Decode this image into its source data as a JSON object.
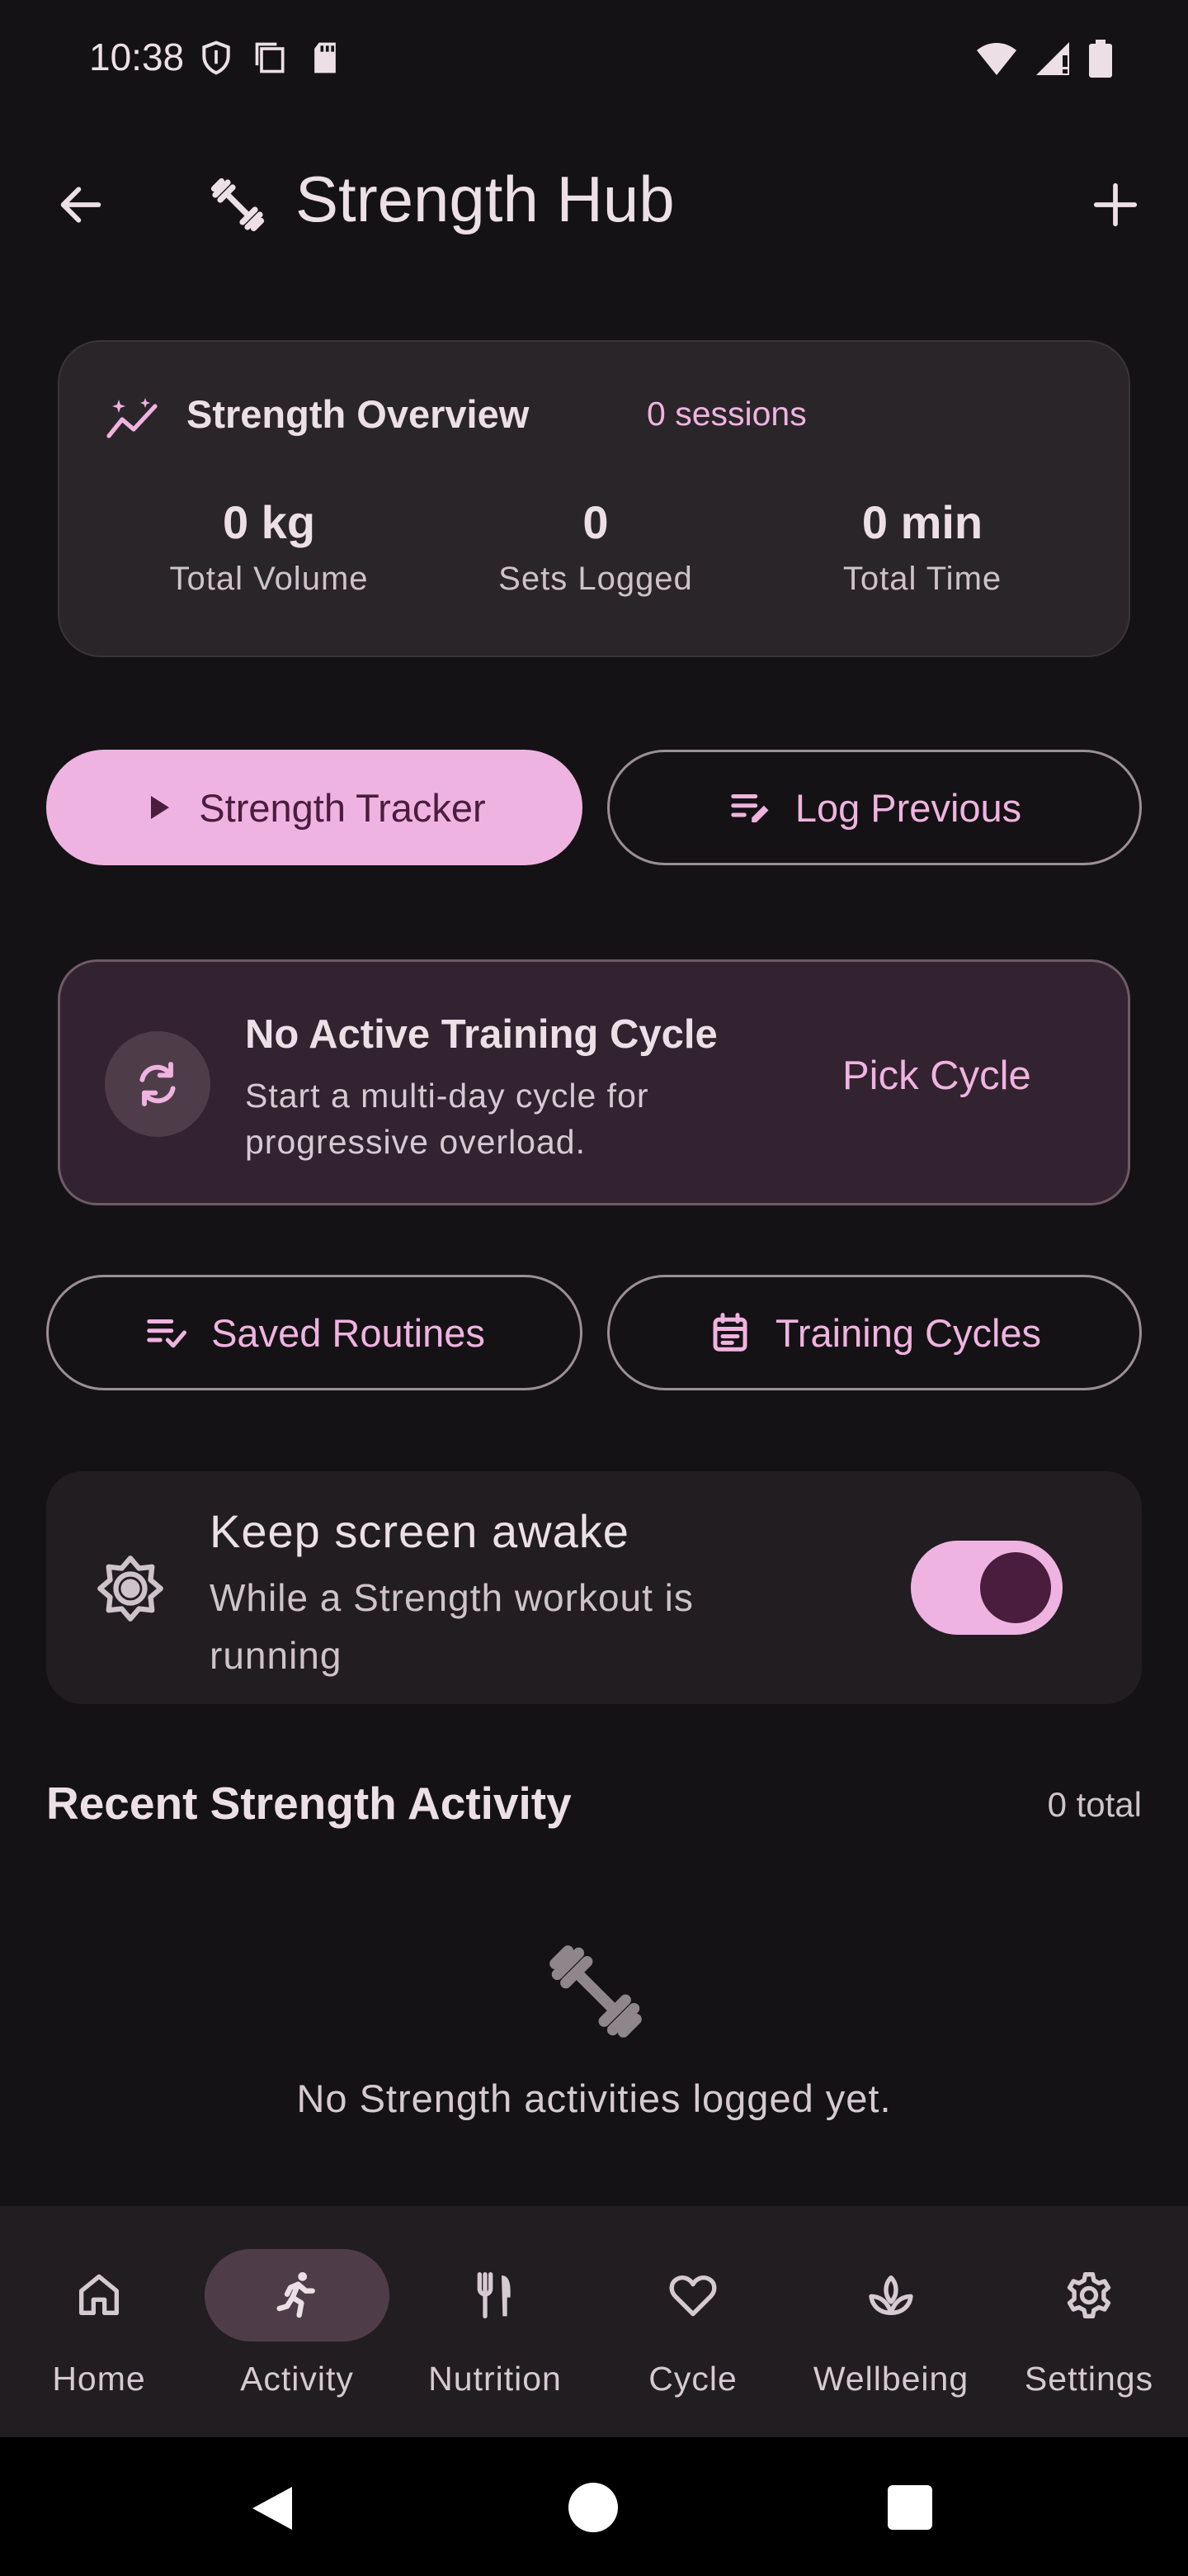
{
  "status_bar": {
    "time": "10:38",
    "icons": [
      "shield-icon",
      "screenshot-icon",
      "sd-card-icon",
      "wifi-icon",
      "signal-icon",
      "battery-icon"
    ]
  },
  "app_bar": {
    "title": "Strength Hub",
    "title_icon": "dumbbell-icon",
    "back_icon": "arrow-back-icon",
    "add_icon": "plus-icon"
  },
  "overview": {
    "title": "Strength Overview",
    "sessions": "0 sessions",
    "stats": [
      {
        "value": "0 kg",
        "label": "Total Volume"
      },
      {
        "value": "0",
        "label": "Sets Logged"
      },
      {
        "value": "0 min",
        "label": "Total Time"
      }
    ]
  },
  "actions": {
    "tracker_label": "Strength Tracker",
    "log_previous_label": "Log Previous"
  },
  "cycle_card": {
    "title": "No Active Training Cycle",
    "description": "Start a multi-day cycle for progressive overload.",
    "action_label": "Pick Cycle"
  },
  "secondary_actions": {
    "routines_label": "Saved Routines",
    "cycles_label": "Training Cycles"
  },
  "awake": {
    "title": "Keep screen awake",
    "description": "While a Strength workout is running",
    "enabled": true
  },
  "recent": {
    "title": "Recent Strength Activity",
    "count": "0 total",
    "empty_text": "No Strength activities logged yet."
  },
  "bottom_nav": {
    "items": [
      {
        "label": "Home",
        "icon": "home-icon",
        "active": false
      },
      {
        "label": "Activity",
        "icon": "run-icon",
        "active": true
      },
      {
        "label": "Nutrition",
        "icon": "fork-knife-icon",
        "active": false
      },
      {
        "label": "Cycle",
        "icon": "heart-icon",
        "active": false
      },
      {
        "label": "Wellbeing",
        "icon": "lotus-icon",
        "active": false
      },
      {
        "label": "Settings",
        "icon": "gear-icon",
        "active": false
      }
    ]
  },
  "colors": {
    "background": "#151215",
    "accent": "#efb3e2",
    "accent_text": "#f0b3e0",
    "on_accent": "#4a1d3f"
  }
}
